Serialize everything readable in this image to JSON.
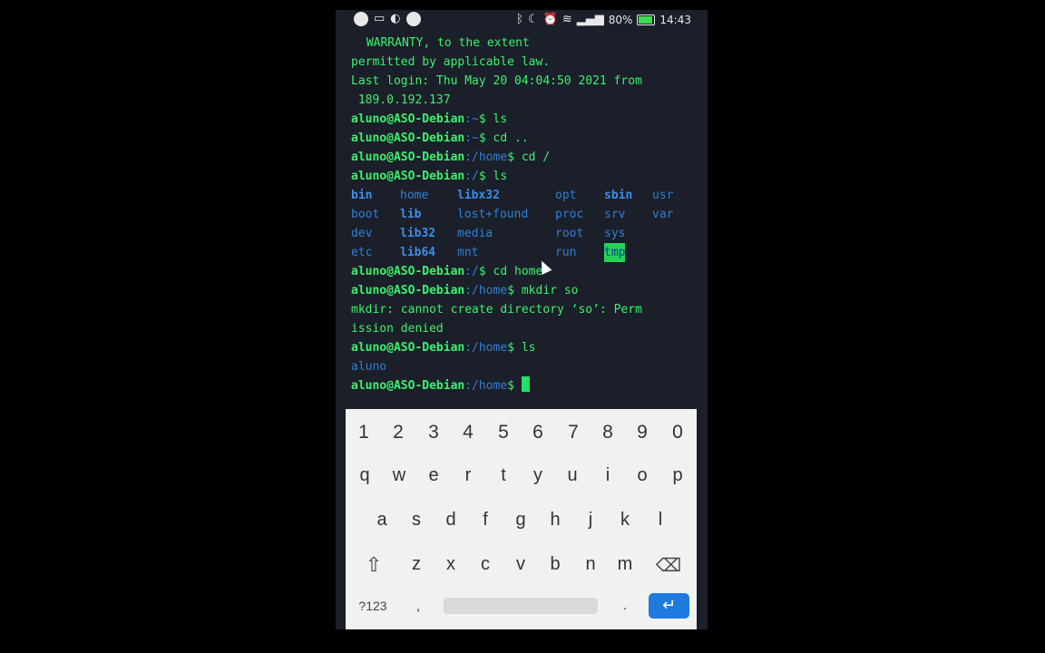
{
  "status_bar": {
    "battery": "80%",
    "time": "14:43",
    "colors": {
      "battery_fill": "#3ddc4a"
    },
    "icons_left": [
      "whatsapp-icon",
      "photo-icon",
      "messenger-icon",
      "cloud-icon"
    ],
    "icons_right": [
      "bluetooth-icon",
      "moon-icon",
      "alarm-icon",
      "wifi-icon",
      "signal-icon",
      "battery-icon"
    ]
  },
  "terminal": {
    "lines": [
      {
        "text": " WARRANTY, to the extent"
      },
      {
        "text": "permitted by applicable law."
      },
      {
        "text": "Last login: Thu May 20 04:04:50 2021 from"
      },
      {
        "text": " 189.0.192.137"
      }
    ],
    "prompt_user": "aluno@ASO-Debian",
    "commands": [
      {
        "path": ":~",
        "cmd": "$ ls"
      },
      {
        "path": ":~",
        "cmd": "$ cd .."
      },
      {
        "path": ":/home",
        "cmd": "$ cd /"
      },
      {
        "path": ":/",
        "cmd": "$ ls"
      }
    ],
    "ls_root": [
      [
        "bin",
        "home",
        "libx32",
        "opt",
        "sbin",
        "usr"
      ],
      [
        "boot",
        "lib",
        "lost+found",
        "proc",
        "srv",
        "var"
      ],
      [
        "dev",
        "lib32",
        "media",
        "root",
        "sys",
        ""
      ],
      [
        "etc",
        "lib64",
        "mnt",
        "run",
        "tmp",
        ""
      ]
    ],
    "commands_after": [
      {
        "path": ":/",
        "cmd": "$ cd home"
      },
      {
        "path": ":/home",
        "cmd": "$ mkdir so"
      }
    ],
    "error_lines": [
      "mkdir: cannot create directory ‘so’: Perm",
      "ission denied"
    ],
    "command_ls_home": {
      "path": ":/home",
      "cmd": "$ ls"
    },
    "ls_home": "aluno",
    "final_prompt": {
      "path": ":/home",
      "cmd": "$ "
    },
    "colors": {
      "user": "#3df06e",
      "path": "#2f7fd6",
      "highlight": "#22d35a"
    }
  },
  "keyboard": {
    "numbers": [
      "1",
      "2",
      "3",
      "4",
      "5",
      "6",
      "7",
      "8",
      "9",
      "0"
    ],
    "row1": [
      "q",
      "w",
      "e",
      "r",
      "t",
      "y",
      "u",
      "i",
      "o",
      "p"
    ],
    "row2": [
      "a",
      "s",
      "d",
      "f",
      "g",
      "h",
      "j",
      "k",
      "l"
    ],
    "row3": [
      "z",
      "x",
      "c",
      "v",
      "b",
      "n",
      "m"
    ],
    "sym_label": "?123",
    "comma": ",",
    "period": ".",
    "shift_icon": "shift-icon",
    "backspace_icon": "backspace-icon",
    "enter_icon": "enter-icon",
    "colors": {
      "enter_bg": "#1f7ae0"
    }
  }
}
